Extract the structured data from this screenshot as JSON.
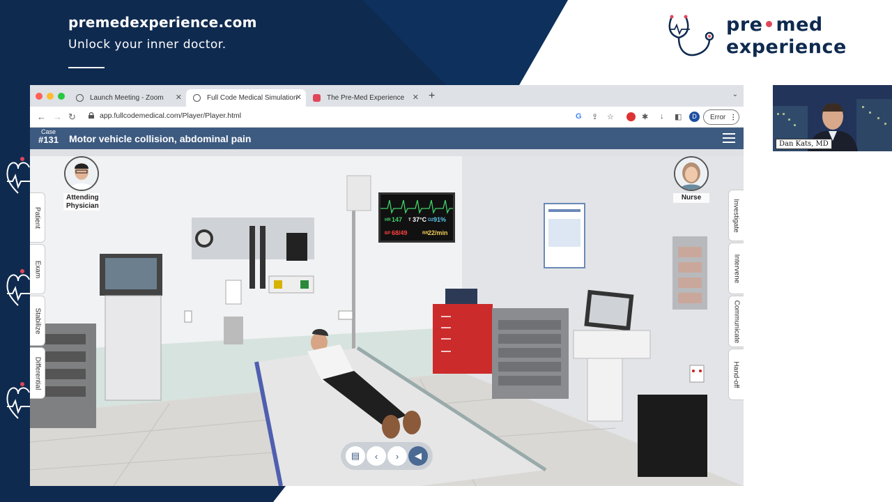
{
  "slide": {
    "site": "premedexperience.com",
    "tagline": "Unlock your inner doctor.",
    "logo_line1_a": "pre",
    "logo_line1_b": "med",
    "logo_line2": "experience"
  },
  "webcam": {
    "name": "Dan Kats, MD"
  },
  "browser": {
    "tabs": [
      {
        "label": "Launch Meeting - Zoom",
        "icon": "globe-icon",
        "active": false
      },
      {
        "label": "Full Code Medical Simulation",
        "icon": "globe-icon",
        "active": true
      },
      {
        "label": "The Pre-Med Experience",
        "icon": "premed-favicon-icon",
        "active": false
      }
    ],
    "url": "app.fullcodemedical.com/Player/Player.html",
    "error_label": "Error",
    "profile_initial": "D"
  },
  "app": {
    "case_label": "Case",
    "case_number": "#131",
    "case_title": "Motor vehicle collision, abdominal pain",
    "characters": {
      "attending_line1": "Attending",
      "attending_line2": "Physician",
      "nurse": "Nurse"
    },
    "left_tabs": [
      "Patient",
      "Exam",
      "Stabilize",
      "Differential"
    ],
    "right_tabs": [
      "Investigate",
      "Intervene",
      "Communicate",
      "Hand-off"
    ],
    "vitals": {
      "hr_label": "HR",
      "hr": "147",
      "temp_label": "T",
      "temp": "37°C",
      "spo2_label": "O2",
      "spo2": "91%",
      "bp_label": "BP",
      "bp": "68/49",
      "rr_label": "RR",
      "rr": "22/min"
    }
  },
  "colors": {
    "navy": "#0f2a4f",
    "accent_pink": "#e0455a",
    "app_header": "#3d5a80"
  }
}
